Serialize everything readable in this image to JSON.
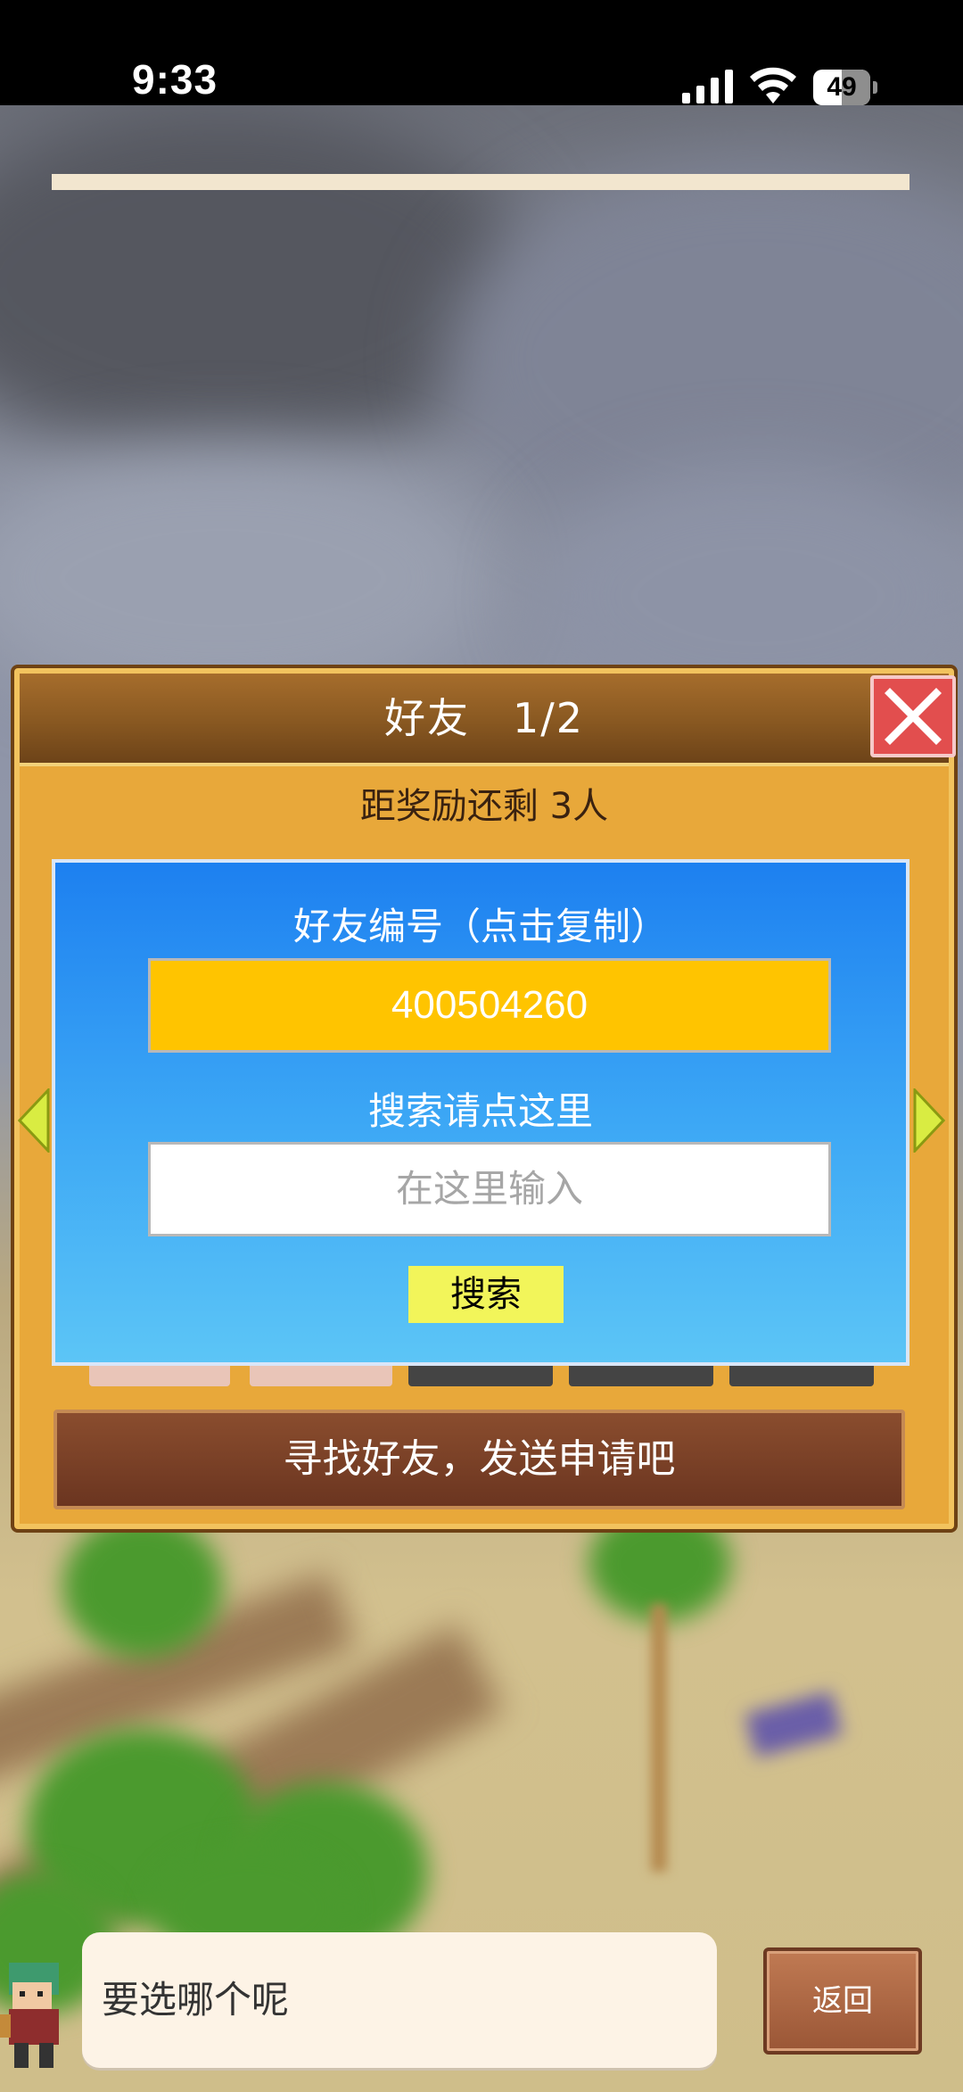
{
  "status_bar": {
    "time": "9:33",
    "battery_level": "49",
    "icons": [
      "signal-icon",
      "wifi-icon",
      "battery-icon"
    ]
  },
  "friend_panel": {
    "title": "好友　1/2",
    "reward_progress": "距奖励还剩 3人",
    "find_friend_button": "寻找好友，发送申请吧",
    "close_icon": "close-icon",
    "nav_icons": [
      "arrow-left-icon",
      "arrow-right-icon"
    ]
  },
  "search_dialog": {
    "id_label": "好友编号（点击复制）",
    "friend_id": "400504260",
    "search_label": "搜索请点这里",
    "search_placeholder": "在这里输入",
    "search_button": "搜索"
  },
  "bottom_bar": {
    "speech_text": "要选哪个呢",
    "back_button": "返回"
  },
  "colors": {
    "panel_bg": "#e8a83a",
    "dialog_bg": "#3ba6f5",
    "id_box": "#ffc400",
    "search_button": "#f2f55a",
    "close_button": "#e24e4e"
  }
}
